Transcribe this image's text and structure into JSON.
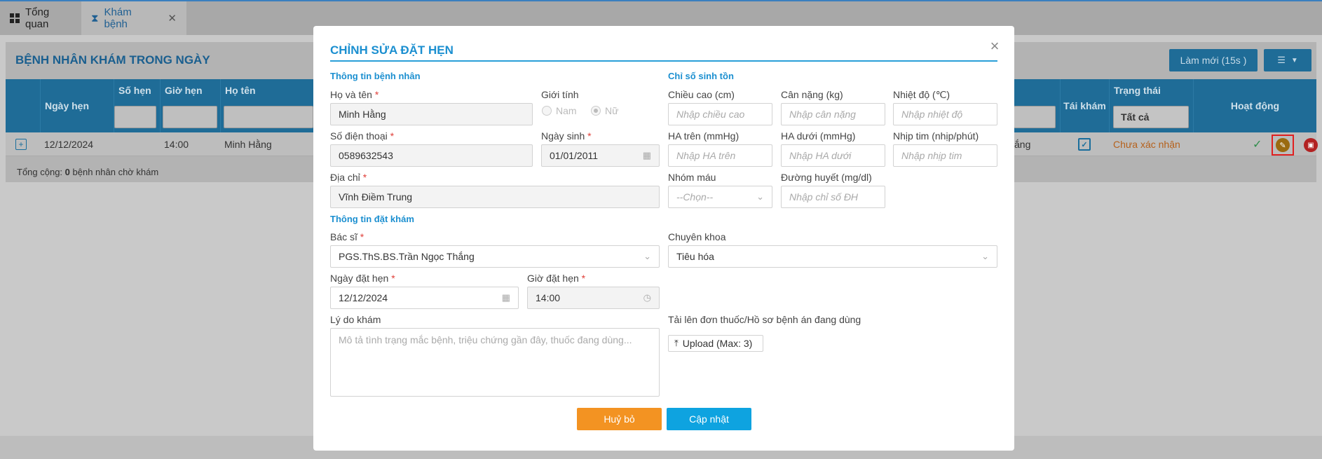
{
  "tabs": {
    "overview": "Tổng quan",
    "exam": "Khám bệnh"
  },
  "panel": {
    "title": "BỆNH NHÂN KHÁM TRONG NGÀY",
    "refresh_label": "Làm mới (15s )"
  },
  "table": {
    "headers": {
      "ngay_hen": "Ngày hẹn",
      "so_hen": "Số hẹn",
      "gio_hen": "Giờ hẹn",
      "ho_ten": "Họ tên",
      "tai_kham": "Tái khám",
      "trang_thai": "Trạng thái",
      "hoat_dong": "Hoạt động"
    },
    "status_filter": "Tất cả",
    "row": {
      "ngay_hen": "12/12/2024",
      "gio_hen": "14:00",
      "ho_ten": "Minh Hằng",
      "bac_si_partial": "ắng",
      "trang_thai": "Chưa xác nhận"
    },
    "total_prefix": "Tổng cộng: ",
    "total_count": "0",
    "total_suffix": " bệnh nhân chờ khám"
  },
  "modal": {
    "title": "CHỈNH SỬA ĐẶT HẸN",
    "patient_section": "Thông tin bệnh nhân",
    "vitals_section": "Chỉ số sinh tồn",
    "booking_section": "Thông tin đặt khám",
    "labels": {
      "ho_ten": "Họ và tên",
      "gioi_tinh": "Giới tính",
      "so_dien_thoai": "Số điện thoại",
      "ngay_sinh": "Ngày sinh",
      "dia_chi": "Địa chỉ",
      "chieu_cao": "Chiều cao (cm)",
      "can_nang": "Cân nặng (kg)",
      "nhiet_do": "Nhiệt độ (℃)",
      "ha_tren": "HA trên (mmHg)",
      "ha_duoi": "HA dưới (mmHg)",
      "nhip_tim": "Nhịp tim (nhịp/phút)",
      "nhom_mau": "Nhóm máu",
      "duong_huyet": "Đường huyết (mg/dl)",
      "bac_si": "Bác sĩ",
      "chuyen_khoa": "Chuyên khoa",
      "ngay_dat_hen": "Ngày đặt hẹn",
      "gio_dat_hen": "Giờ đặt hẹn",
      "ly_do_kham": "Lý do khám",
      "tai_len": "Tải lên đơn thuốc/Hồ sơ bệnh án đang dùng"
    },
    "values": {
      "ho_ten": "Minh Hằng",
      "so_dien_thoai": "0589632543",
      "ngay_sinh": "01/01/2011",
      "dia_chi": "Vĩnh Điềm Trung",
      "bac_si": "PGS.ThS.BS.Trần Ngọc Thắng",
      "chuyen_khoa": "Tiêu hóa",
      "ngay_dat_hen": "12/12/2024",
      "gio_dat_hen": "14:00",
      "nhom_mau": "--Chọn--"
    },
    "gender_options": {
      "male": "Nam",
      "female": "Nữ",
      "selected": "Nữ"
    },
    "placeholders": {
      "chieu_cao": "Nhập chiều cao",
      "can_nang": "Nhập cân nặng",
      "nhiet_do": "Nhập nhiệt độ",
      "ha_tren": "Nhập HA trên",
      "ha_duoi": "Nhập HA dưới",
      "nhip_tim": "Nhập nhịp tim",
      "duong_huyet": "Nhập chỉ số ĐH",
      "ly_do_kham": "Mô tả tình trạng mắc bệnh, triệu chứng gần đây, thuốc đang dùng..."
    },
    "upload_label": "Upload (Max: 3)",
    "cancel_label": "Huỷ bỏ",
    "update_label": "Cập nhật"
  },
  "colors": {
    "accent": "#1b8fd0",
    "cancel": "#f39322",
    "update": "#0ea3e0",
    "required": "#e0403a",
    "status_pending": "#e5731c"
  }
}
